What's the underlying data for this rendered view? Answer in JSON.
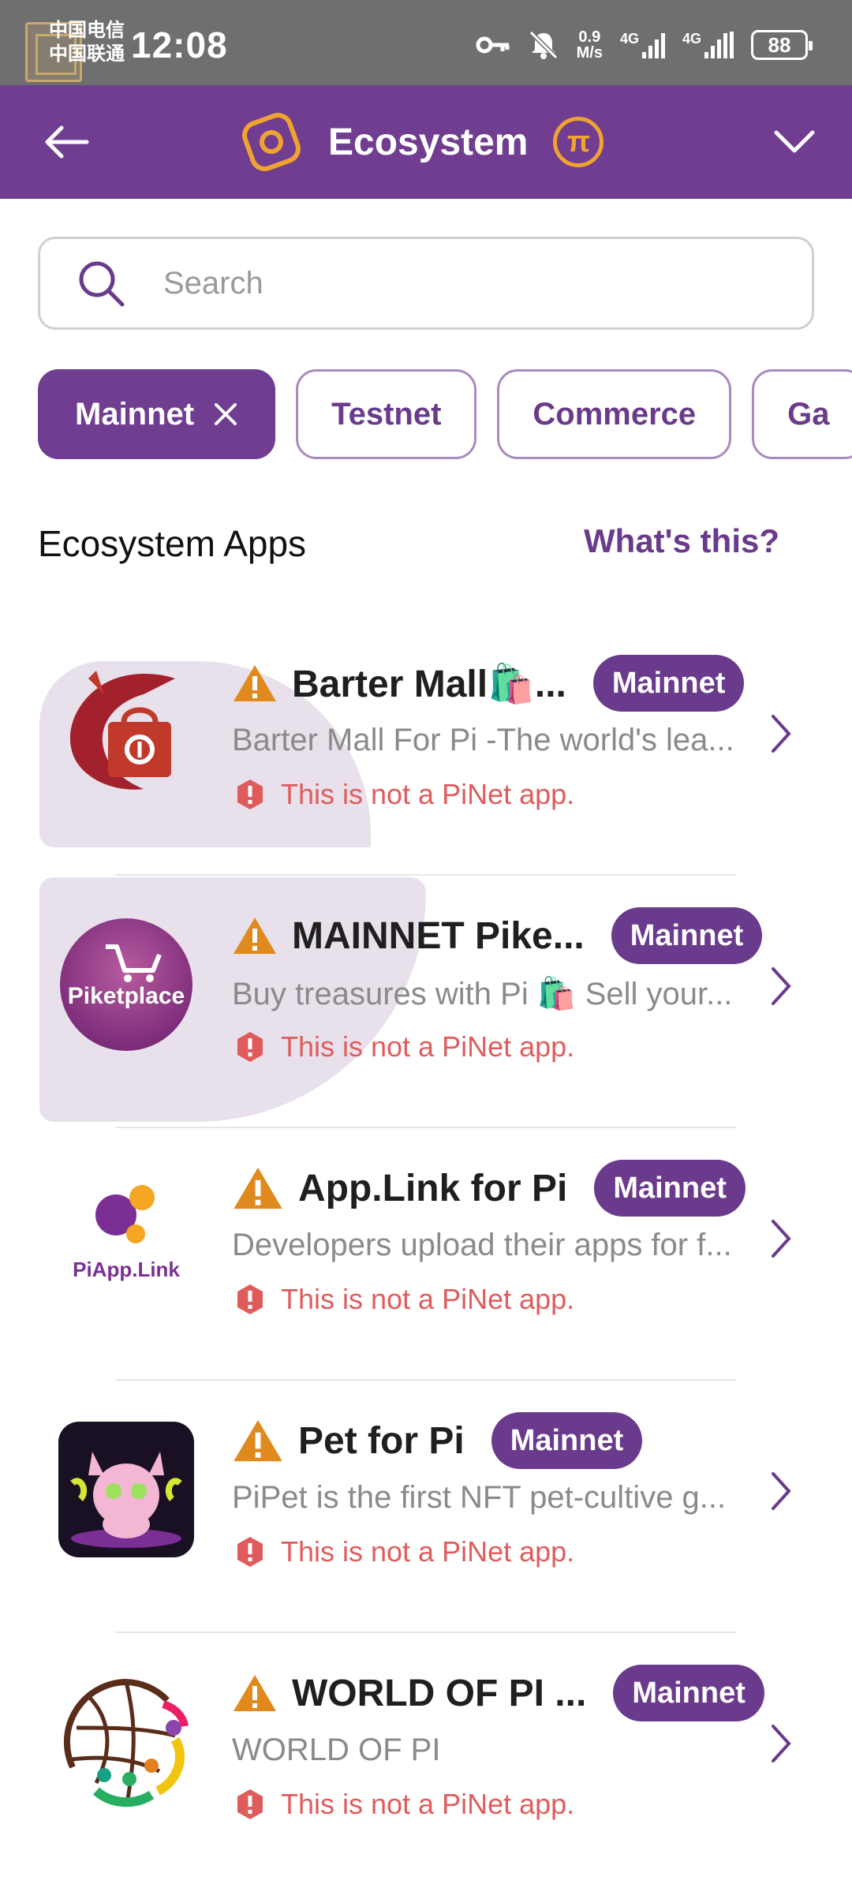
{
  "status_bar": {
    "carrier_line1": "中国电信",
    "carrier_line2": "中国联通",
    "time": "12:08",
    "speed_value": "0.9",
    "speed_unit": "M/s",
    "network_1": "4G",
    "network_2": "4G",
    "battery": "88"
  },
  "header": {
    "title": "Ecosystem",
    "coin_symbol": "π"
  },
  "search": {
    "placeholder": "Search"
  },
  "filters": [
    {
      "label": "Mainnet",
      "active": true
    },
    {
      "label": "Testnet",
      "active": false
    },
    {
      "label": "Commerce",
      "active": false
    },
    {
      "label": "Ga",
      "active": false
    }
  ],
  "section": {
    "title": "Ecosystem Apps",
    "help_link": "What's this?"
  },
  "apps": [
    {
      "name": "Barter Mall🛍️...",
      "badge": "Mainnet",
      "description": "Barter Mall For Pi -The world's lea...",
      "warning": "This is not a PiNet app.",
      "icon": "barter-mall-dragon-icon"
    },
    {
      "name": "MAINNET Pike...",
      "badge": "Mainnet",
      "description": "Buy treasures with Pi 🛍️ Sell your...",
      "warning": "This is not a PiNet app.",
      "icon": "piketplace-cart-icon",
      "icon_text": "Piketplace"
    },
    {
      "name": "App.Link for Pi",
      "badge": "Mainnet",
      "description": "Developers upload their apps for f...",
      "warning": "This is not a PiNet app.",
      "icon": "piapp-link-dots-icon",
      "icon_text": "PiApp.Link"
    },
    {
      "name": "Pet for Pi",
      "badge": "Mainnet",
      "description": "PiPet is the first NFT pet-cultive g...",
      "warning": "This is not a PiNet app.",
      "icon": "pipet-cat-icon"
    },
    {
      "name": "WORLD OF PI ...",
      "badge": "Mainnet",
      "description": "WORLD OF PI",
      "warning": "This is not a PiNet app.",
      "icon": "world-of-pi-globe-icon"
    }
  ],
  "colors": {
    "brand_purple": "#703d91",
    "badge_purple": "#6a3a8c",
    "warning_red": "#e05c5c",
    "warning_orange": "#e08a1e",
    "coin_orange": "#f0a330"
  }
}
